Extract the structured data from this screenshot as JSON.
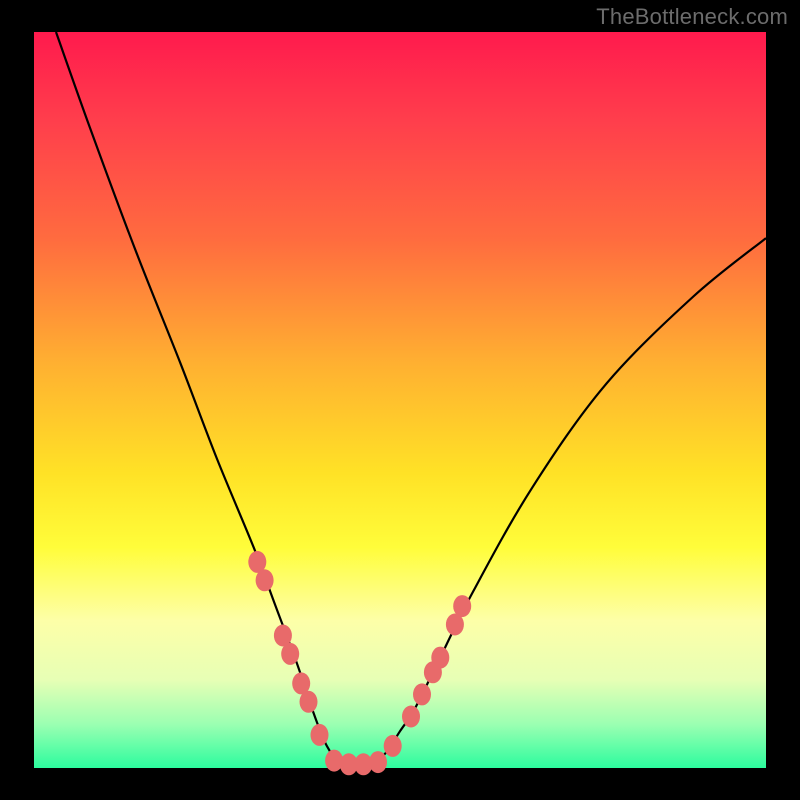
{
  "watermark": "TheBottleneck.com",
  "chart_data": {
    "type": "line",
    "title": "",
    "xlabel": "",
    "ylabel": "",
    "xlim": [
      0,
      100
    ],
    "ylim": [
      0,
      100
    ],
    "grid": false,
    "legend": false,
    "series": [
      {
        "name": "bottleneck-curve",
        "x": [
          3,
          8,
          14,
          20,
          25,
          30,
          33,
          36,
          38,
          40,
          42,
          44,
          46,
          48,
          50,
          52,
          55,
          60,
          68,
          78,
          90,
          100
        ],
        "y": [
          100,
          86,
          70,
          55,
          42,
          30,
          22,
          14,
          8,
          3,
          0.5,
          0,
          0.5,
          2,
          5,
          8,
          14,
          24,
          38,
          52,
          64,
          72
        ]
      }
    ],
    "markers": {
      "name": "sample-points",
      "x": [
        30.5,
        31.5,
        34.0,
        35.0,
        36.5,
        37.5,
        39.0,
        41.0,
        43.0,
        45.0,
        47.0,
        49.0,
        51.5,
        53.0,
        54.5,
        55.5,
        57.5,
        58.5
      ],
      "y": [
        28.0,
        25.5,
        18.0,
        15.5,
        11.5,
        9.0,
        4.5,
        1.0,
        0.5,
        0.5,
        0.8,
        3.0,
        7.0,
        10.0,
        13.0,
        15.0,
        19.5,
        22.0
      ]
    },
    "background_gradient": {
      "stops": [
        {
          "pos": 0.0,
          "color": "#ff1a4d"
        },
        {
          "pos": 0.12,
          "color": "#ff3e4c"
        },
        {
          "pos": 0.28,
          "color": "#ff6b3f"
        },
        {
          "pos": 0.45,
          "color": "#ffb031"
        },
        {
          "pos": 0.6,
          "color": "#ffe226"
        },
        {
          "pos": 0.7,
          "color": "#fffd3a"
        },
        {
          "pos": 0.8,
          "color": "#fdffa8"
        },
        {
          "pos": 0.88,
          "color": "#e7ffb5"
        },
        {
          "pos": 0.94,
          "color": "#9cffb2"
        },
        {
          "pos": 1.0,
          "color": "#2cfc9e"
        }
      ]
    }
  }
}
